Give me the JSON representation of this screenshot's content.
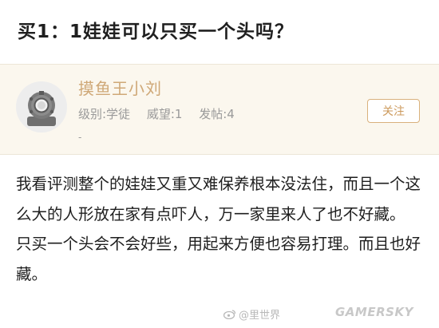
{
  "post": {
    "title": "买1：1娃娃可以只买一个头吗？"
  },
  "author": {
    "name": "摸鱼王小刘",
    "level_label": "级别:学徒",
    "prestige_label": "威望:1",
    "posts_label": "发帖:4",
    "extra": "-",
    "follow_label": "关注"
  },
  "content": {
    "paragraphs": [
      "我看评测整个的娃娃又重又难保养根本没法住，而且一个这么大的人形放在家有点吓人，万一家里来人了也不好藏。",
      "只买一个头会不会好些，用起来方便也容易打理。而且也好藏。"
    ]
  },
  "watermarks": {
    "weibo": "@里世界",
    "brand": "GAMERSKY"
  },
  "icons": {
    "avatar": "diving-helmet-icon",
    "weibo": "weibo-icon"
  },
  "colors": {
    "username": "#cfa877",
    "follow_border": "#d9b17c",
    "card_background": "#fbf7ee"
  }
}
